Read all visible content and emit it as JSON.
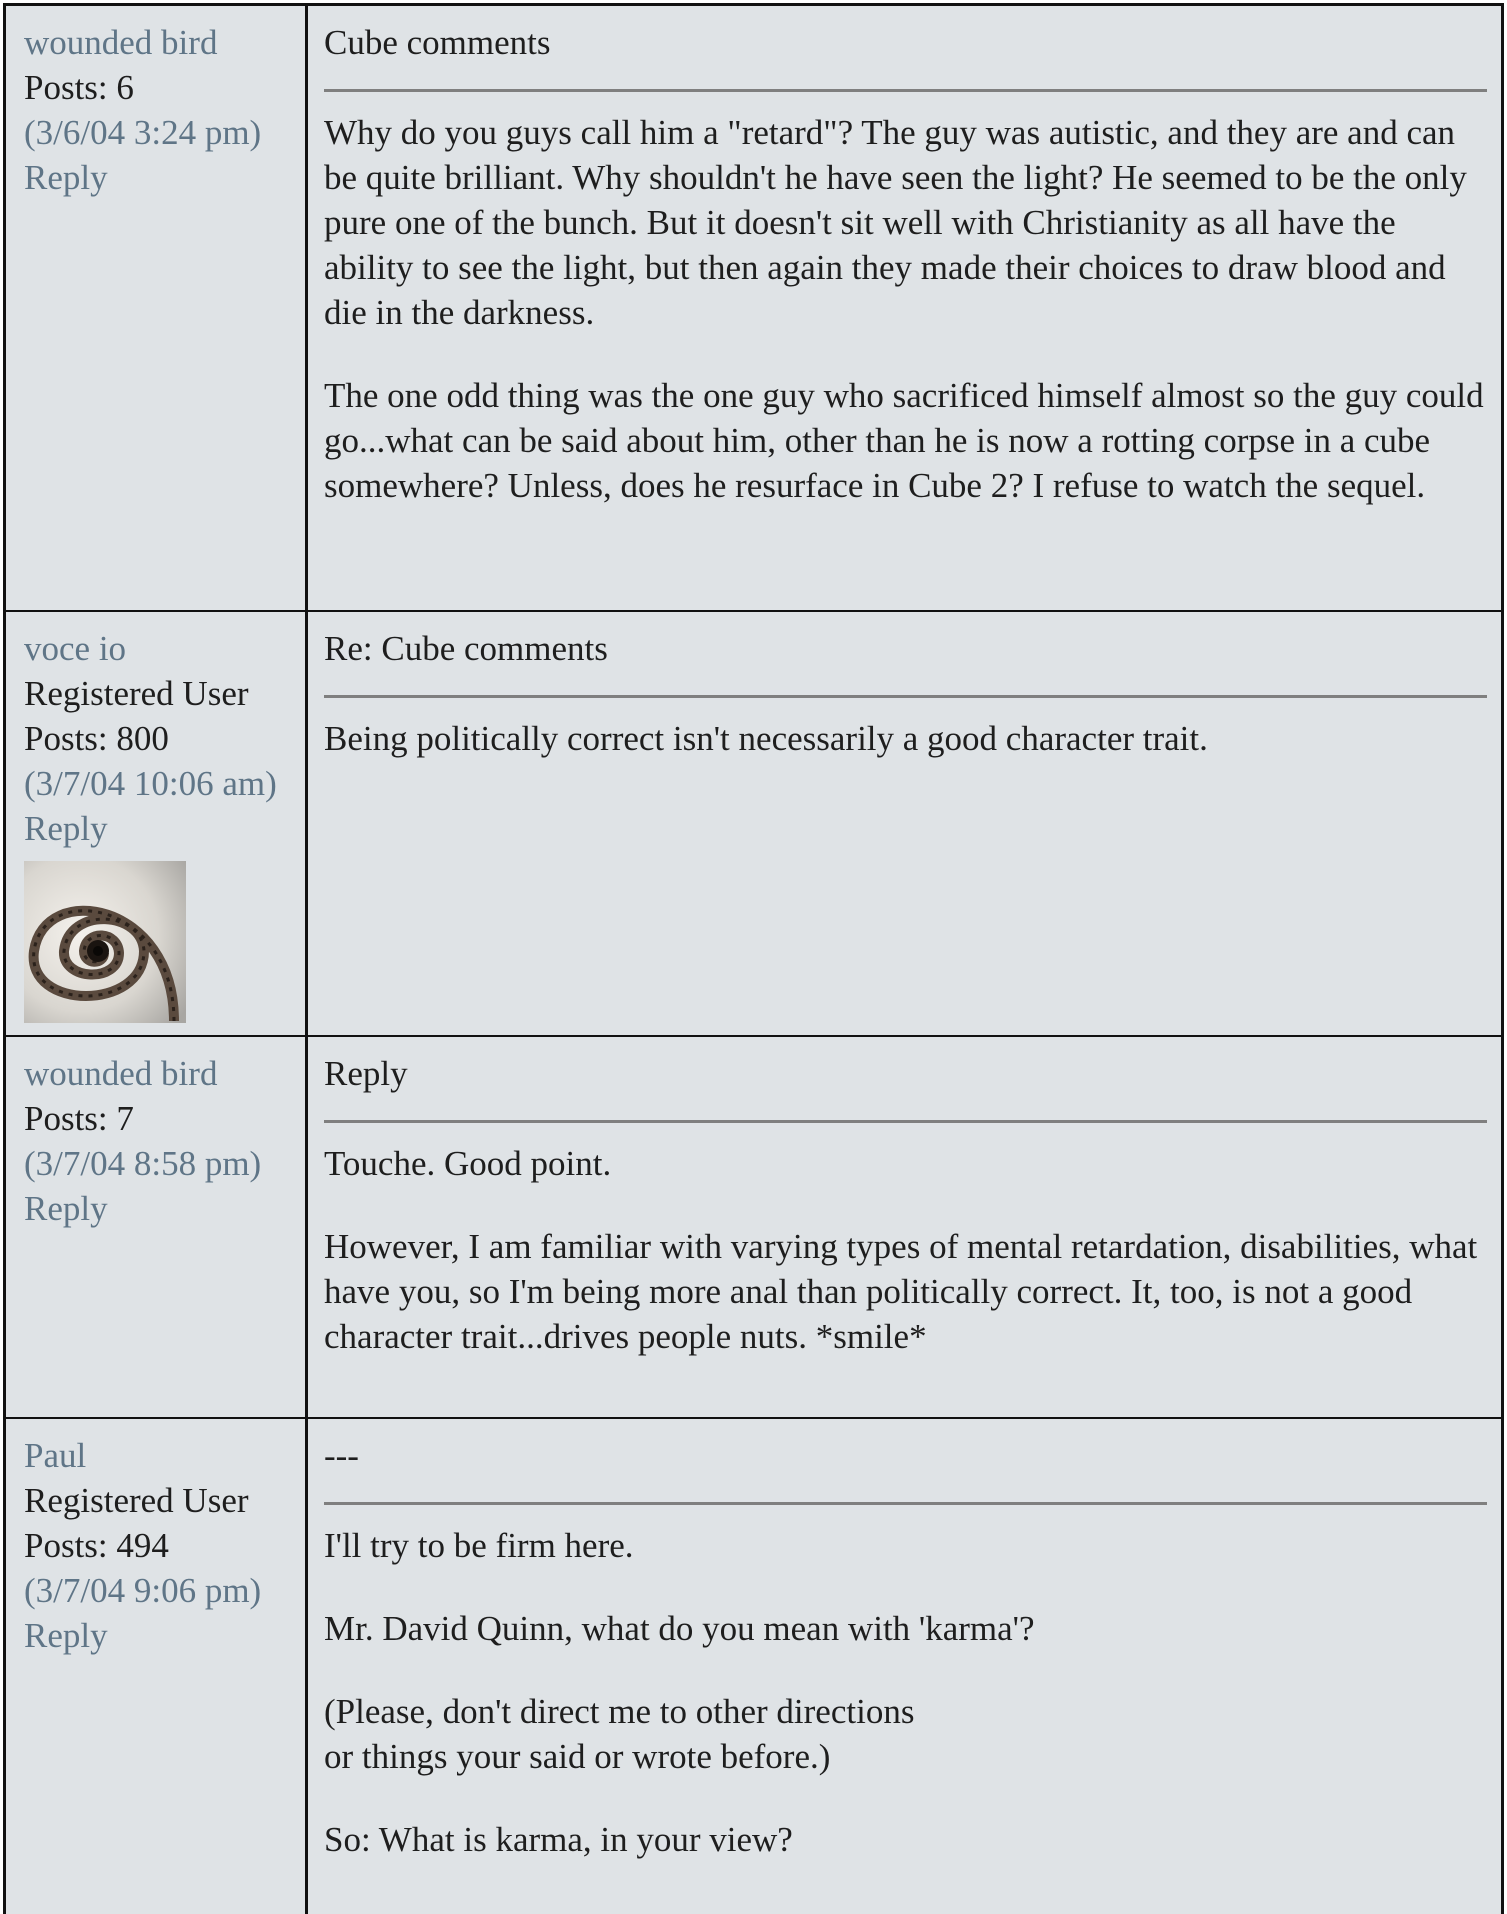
{
  "posts": [
    {
      "author": "wounded bird",
      "role": "",
      "posts_count": "Posts: 6",
      "timestamp": "(3/6/04 3:24 pm)",
      "reply_label": "Reply",
      "subject": "Cube comments",
      "paragraphs": [
        "Why do you guys call him a \"retard\"? The guy was autistic, and they are and can be quite brilliant. Why shouldn't he have seen the light? He seemed to be the only pure one of the bunch. But it doesn't sit well with Christianity as all have the ability to see the light, but then again they made their choices to draw blood and die in the darkness.",
        "The one odd thing was the one guy who sacrificed himself almost so the guy could go...what can be said about him, other than he is now a rotting corpse in a cube somewhere? Unless, does he resurface in Cube 2? I refuse to watch the sequel."
      ]
    },
    {
      "author": "voce io",
      "role": "Registered User",
      "posts_count": "Posts: 800",
      "timestamp": "(3/7/04 10:06 am)",
      "reply_label": "Reply",
      "avatar_icon": "spiral-staircase-avatar",
      "subject": "Re: Cube comments",
      "paragraphs": [
        "Being politically correct isn't necessarily a good character trait."
      ]
    },
    {
      "author": "wounded bird",
      "role": "",
      "posts_count": "Posts: 7",
      "timestamp": "(3/7/04 8:58 pm)",
      "reply_label": "Reply",
      "subject": "Reply",
      "paragraphs": [
        "Touche. Good point.",
        "However, I am familiar with varying types of mental retardation, disabilities, what have you, so I'm being more anal than politically correct. It, too, is not a good character trait...drives people nuts. *smile*"
      ]
    },
    {
      "author": "Paul",
      "role": "Registered User",
      "posts_count": "Posts: 494",
      "timestamp": "(3/7/04 9:06 pm)",
      "reply_label": "Reply",
      "subject": "---",
      "paragraphs": [
        "I'll try to be firm here.",
        "Mr. David Quinn, what do you mean with 'karma'?",
        "(Please, don't direct me to other directions\nor things your said or wrote before.)",
        "So: What is karma, in your view?"
      ]
    }
  ],
  "colors": {
    "background": "#dfe3e6",
    "link": "#5f7587",
    "text": "#1e1e1e",
    "border": "#111111",
    "separator": "#7f7f7f"
  }
}
